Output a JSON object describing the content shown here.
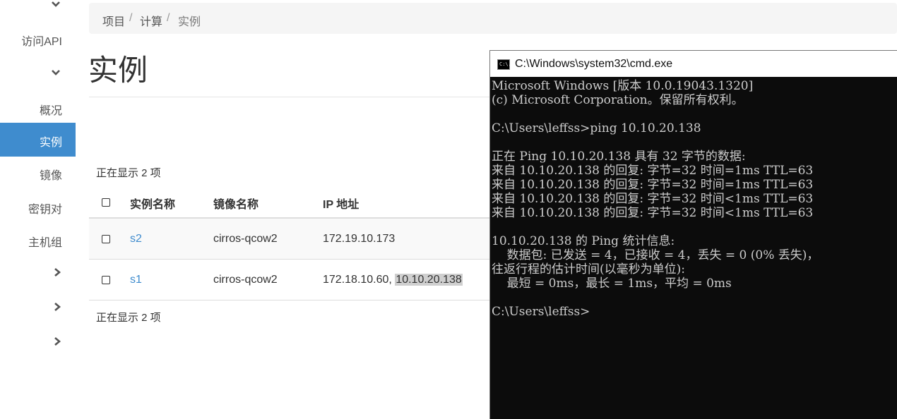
{
  "sidebar": {
    "api_access": "访问API",
    "items": {
      "overview": "概况",
      "instances": "实例",
      "images": "镜像",
      "key_pairs": "密钥对",
      "host_groups": "主机组"
    }
  },
  "breadcrumb": {
    "items": [
      "项目",
      "计算",
      "实例"
    ],
    "separator": "/"
  },
  "page": {
    "title": "实例",
    "count_top": "正在显示 2 项",
    "count_bottom": "正在显示 2 项"
  },
  "table": {
    "headers": [
      "实例名称",
      "镜像名称",
      "IP 地址"
    ],
    "rows": [
      {
        "name": "s2",
        "image": "cirros-qcow2",
        "ip": "172.19.10.173",
        "ip_highlight": ""
      },
      {
        "name": "s1",
        "image": "cirros-qcow2",
        "ip": "172.18.10.60, ",
        "ip_highlight": "10.10.20.138"
      }
    ]
  },
  "cmd": {
    "title": "C:\\Windows\\system32\\cmd.exe",
    "icon_text": "C:\\.",
    "lines": [
      "Microsoft Windows [版本 10.0.19043.1320]",
      "(c) Microsoft Corporation。保留所有权利。",
      "",
      "C:\\Users\\leffss>ping 10.10.20.138",
      "",
      "正在 Ping 10.10.20.138 具有 32 字节的数据:",
      "来自 10.10.20.138 的回复: 字节=32 时间=1ms TTL=63",
      "来自 10.10.20.138 的回复: 字节=32 时间=1ms TTL=63",
      "来自 10.10.20.138 的回复: 字节=32 时间<1ms TTL=63",
      "来自 10.10.20.138 的回复: 字节=32 时间<1ms TTL=63",
      "",
      "10.10.20.138 的 Ping 统计信息:",
      "    数据包: 已发送 = 4，已接收 = 4，丢失 = 0 (0% 丢失)，",
      "往返行程的估计时间(以毫秒为单位):",
      "    最短 = 0ms，最长 = 1ms，平均 = 0ms",
      "",
      "C:\\Users\\leffss>"
    ]
  },
  "colors": {
    "accent": "#3f8cce",
    "cmd_bg": "#0c0c0c",
    "cmd_text": "#cccccc"
  }
}
